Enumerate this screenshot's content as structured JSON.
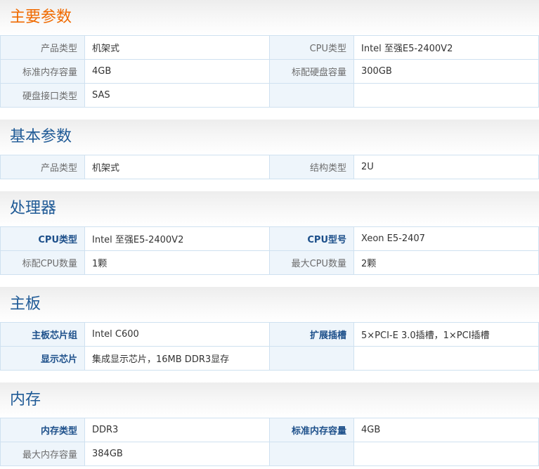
{
  "sections": [
    {
      "title": "主要参数",
      "rows": [
        {
          "k1": "产品类型",
          "v1": "机架式",
          "k2": "CPU类型",
          "v2": "Intel 至强E5-2400V2"
        },
        {
          "k1": "标准内存容量",
          "v1": "4GB",
          "k2": "标配硬盘容量",
          "v2": "300GB"
        },
        {
          "k1": "硬盘接口类型",
          "v1": "SAS",
          "k2": "",
          "v2": ""
        }
      ]
    },
    {
      "title": "基本参数",
      "rows": [
        {
          "k1": "产品类型",
          "v1": "机架式",
          "k2": "结构类型",
          "v2": "2U"
        }
      ]
    },
    {
      "title": "处理器",
      "rows": [
        {
          "k1": "CPU类型",
          "v1": "Intel 至强E5-2400V2",
          "k2": "CPU型号",
          "v2": "Xeon E5-2407"
        },
        {
          "k1": "标配CPU数量",
          "v1": "1颗",
          "k2": "最大CPU数量",
          "v2": "2颗"
        }
      ]
    },
    {
      "title": "主板",
      "rows": [
        {
          "k1": "主板芯片组",
          "v1": "Intel C600",
          "k2": "扩展插槽",
          "v2": "5×PCI-E 3.0插槽，1×PCI插槽"
        },
        {
          "k1": "显示芯片",
          "v1": "集成显示芯片，16MB DDR3显存",
          "k2": "",
          "v2": ""
        }
      ]
    },
    {
      "title": "内存",
      "rows": [
        {
          "k1": "内存类型",
          "v1": "DDR3",
          "k2": "标准内存容量",
          "v2": "4GB"
        },
        {
          "k1": "最大内存容量",
          "v1": "384GB",
          "k2": "",
          "v2": ""
        }
      ]
    }
  ],
  "colors": {
    "title_primary": "#f06a00",
    "title_section": "#1f5a96",
    "key_bold": "#1c4f8a",
    "key_normal": "#6c6c6c",
    "border": "#cfe1f0",
    "key_bg": "#eef5fb"
  }
}
